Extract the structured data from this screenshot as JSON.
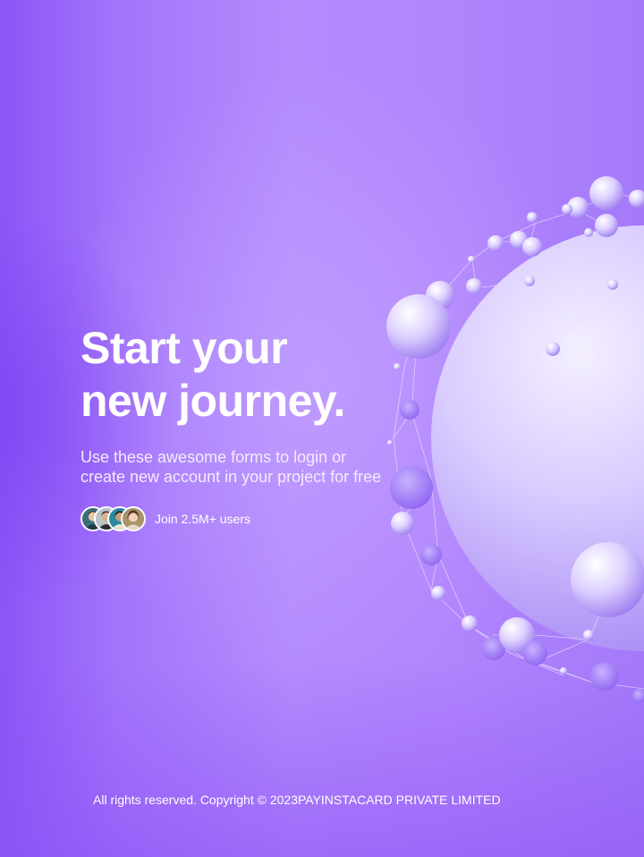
{
  "hero": {
    "title_line1": "Start your",
    "title_line2": "new journey.",
    "subtitle_line1": "Use these awesome forms to login or",
    "subtitle_line2": "create new account in your project for free"
  },
  "users": {
    "label": "Join 2.5M+ users",
    "avatar_count": 4
  },
  "footer": {
    "copyright": "All rights reserved. Copyright © 2023PAYINSTACARD PRIVATE LIMITED"
  },
  "colors": {
    "background_primary": "#a374fb",
    "background_deep": "#8b55f7",
    "text": "#ffffff",
    "sphere": "#d9ccff"
  }
}
